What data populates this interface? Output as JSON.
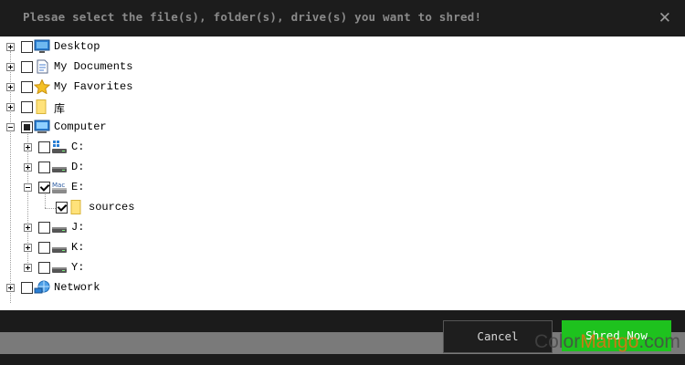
{
  "window": {
    "title": "Plesae select the file(s), folder(s), drive(s) you want to shred!",
    "close_glyph": "✕"
  },
  "tree": {
    "desktop": "Desktop",
    "my_documents": "My Documents",
    "my_favorites": "My Favorites",
    "library": "库",
    "computer": "Computer",
    "drive_c": "C:",
    "drive_d": "D:",
    "drive_e": "E:",
    "sources": "sources",
    "drive_j": "J:",
    "drive_k": "K:",
    "drive_y": "Y:",
    "network": "Network"
  },
  "buttons": {
    "cancel": "Cancel",
    "shred_now": "Shred Now"
  },
  "watermark": {
    "part1": "Color",
    "part2": "Mango",
    "part3": ".com"
  },
  "colors": {
    "shred_button": "#1ec21e",
    "title_text": "#8a8a8a",
    "window_background": "#1a1a1a"
  }
}
